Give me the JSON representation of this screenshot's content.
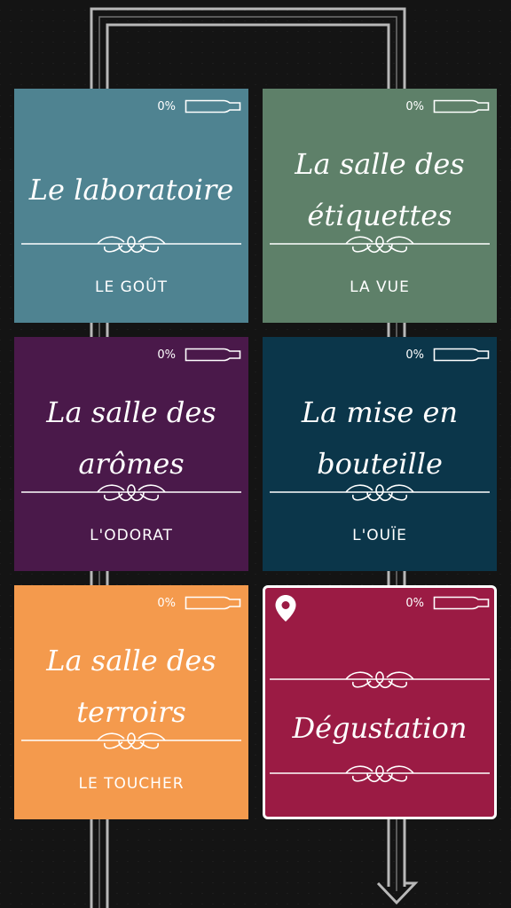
{
  "cards": [
    {
      "title": "Le laboratoire",
      "subtitle": "LE GOÛT",
      "progress_text": "0%",
      "progress": 0,
      "color": "#4f8391"
    },
    {
      "title": "La salle des étiquettes",
      "subtitle": "LA VUE",
      "progress_text": "0%",
      "progress": 0,
      "color": "#5e8069"
    },
    {
      "title": "La salle des arômes",
      "subtitle": "L'ODORAT",
      "progress_text": "0%",
      "progress": 0,
      "color": "#4a194a"
    },
    {
      "title": "La mise en bouteille",
      "subtitle": "L'OUÏE",
      "progress_text": "0%",
      "progress": 0,
      "color": "#0b364a"
    },
    {
      "title": "La salle des terroirs",
      "subtitle": "LE TOUCHER",
      "progress_text": "0%",
      "progress": 0,
      "color": "#f49a4d"
    },
    {
      "title": "Dégustation",
      "progress_text": "0%",
      "progress": 0,
      "color": "#9b1b44",
      "icon": "location-pin-icon",
      "current": true
    }
  ],
  "icons": {
    "bottle": "bottle-icon",
    "flourish": "flourish-icon",
    "path": "path-arrow-icon"
  }
}
